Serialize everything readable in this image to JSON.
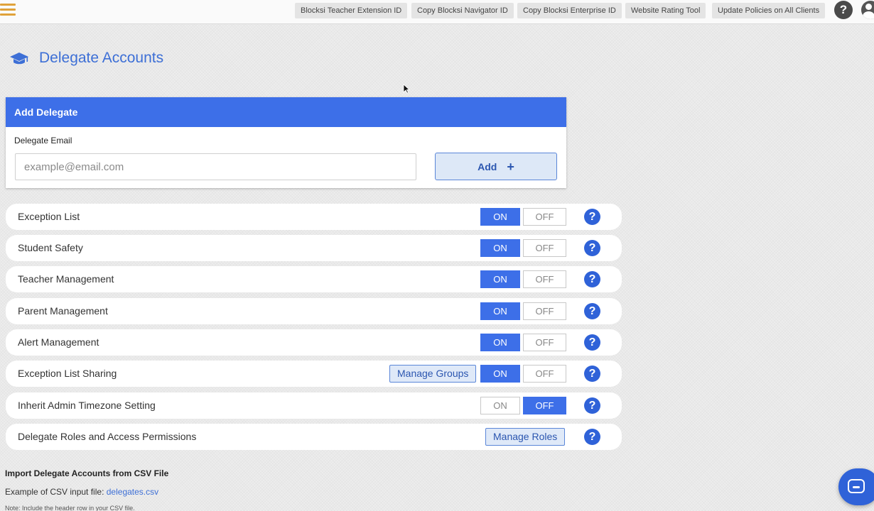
{
  "topbar": {
    "buttons": [
      "Blocksi Teacher Extension ID",
      "Copy Blocksi Navigator ID",
      "Copy Blocksi Enterprise ID",
      "Website Rating Tool",
      "Update Policies on All Clients"
    ],
    "help_label": "?"
  },
  "page": {
    "title": "Delegate Accounts"
  },
  "add_delegate": {
    "header": "Add Delegate",
    "email_label": "Delegate Email",
    "email_placeholder": "example@email.com",
    "email_value": "",
    "add_label": "Add",
    "add_plus": "+"
  },
  "settings": [
    {
      "label": "Exception List",
      "on_label": "ON",
      "off_label": "OFF",
      "state": "on"
    },
    {
      "label": "Student Safety",
      "on_label": "ON",
      "off_label": "OFF",
      "state": "on"
    },
    {
      "label": "Teacher Management",
      "on_label": "ON",
      "off_label": "OFF",
      "state": "on"
    },
    {
      "label": "Parent Management",
      "on_label": "ON",
      "off_label": "OFF",
      "state": "on"
    },
    {
      "label": "Alert Management",
      "on_label": "ON",
      "off_label": "OFF",
      "state": "on"
    },
    {
      "label": "Exception List Sharing",
      "on_label": "ON",
      "off_label": "OFF",
      "state": "on",
      "manage_label": "Manage Groups"
    },
    {
      "label": "Inherit Admin Timezone Setting",
      "on_label": "ON",
      "off_label": "OFF",
      "state": "off"
    },
    {
      "label": "Delegate Roles and Access Permissions",
      "manage_label": "Manage Roles"
    }
  ],
  "help_icon_label": "?",
  "import": {
    "title": "Import Delegate Accounts from CSV File",
    "example_text": "Example of CSV input file:",
    "example_link": "delegates.csv",
    "note": "Note: Include the header row in your CSV file."
  },
  "colors": {
    "accent": "#3d6fe8",
    "title": "#3d6fd6",
    "hamburger": "#e0a23a"
  }
}
